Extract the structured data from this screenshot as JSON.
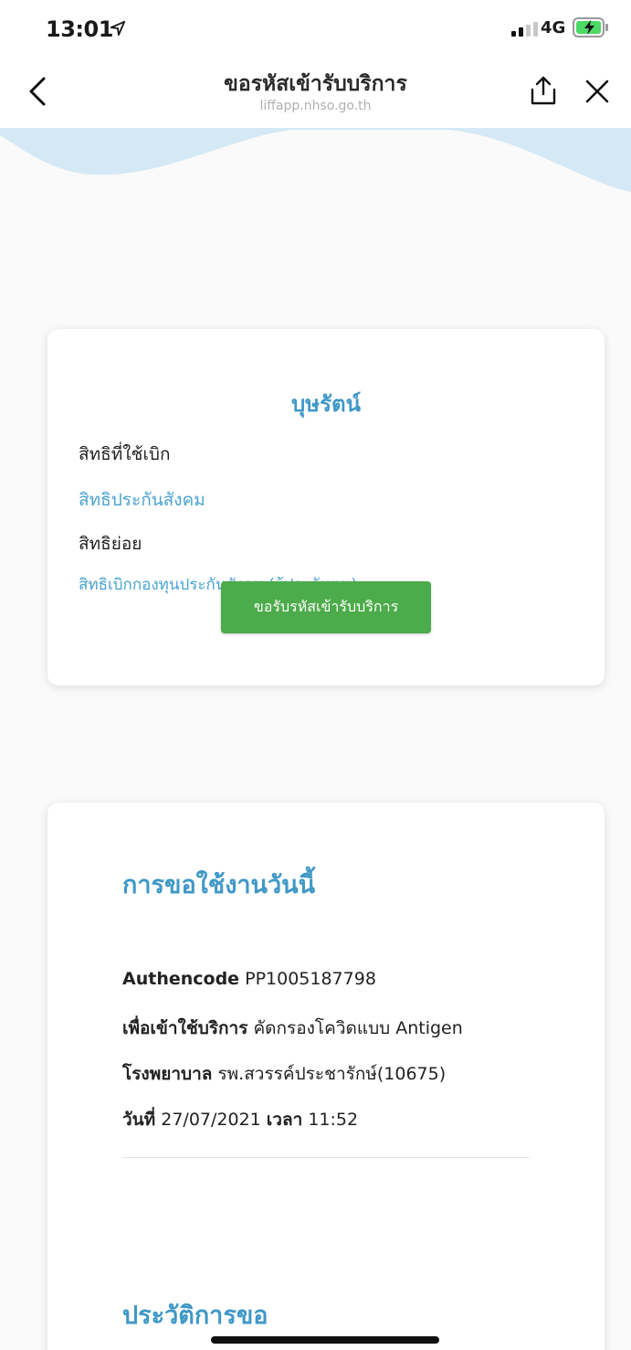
{
  "status_bar": {
    "time": "13:01",
    "network": "4G"
  },
  "nav": {
    "title": "ขอรหัสเข้ารับบริการ",
    "subtitle": "liffapp.nhso.go.th"
  },
  "rights_card": {
    "name": "บุษรัตน์",
    "right_label": "สิทธิที่ใช้เบิก",
    "right_value": "สิทธิประกันสังคม",
    "subright_label": "สิทธิย่อย",
    "subright_value": "สิทธิเบิกกองทุนประกันสังคม (ผู้ประกันตน)",
    "button_label": "ขอรับรหัสเข้ารับบริการ"
  },
  "today_card": {
    "title": "การขอใช้งานวันนี้",
    "authencode_label": "Authencode",
    "authencode_value": "PP1005187798",
    "purpose_label": "เพื่อเข้าใช้บริการ",
    "purpose_value": "คัดกรองโควิดแบบ Antigen",
    "hospital_label": "โรงพยาบาล",
    "hospital_value": "รพ.สวรรค์ประชารักษ์(10675)",
    "date_label": "วันที่",
    "date_value": "27/07/2021",
    "time_label": "เวลา",
    "time_value": "11:52",
    "history_title": "ประวัติการขอ"
  },
  "colors": {
    "accent_blue": "#3f98c7",
    "button_green": "#4cab4a",
    "wave_blue": "#d4e8f5"
  },
  "icons": [
    "location-arrow-icon",
    "signal-icon",
    "battery-charging-icon",
    "back-chevron-icon",
    "share-icon",
    "close-icon"
  ]
}
